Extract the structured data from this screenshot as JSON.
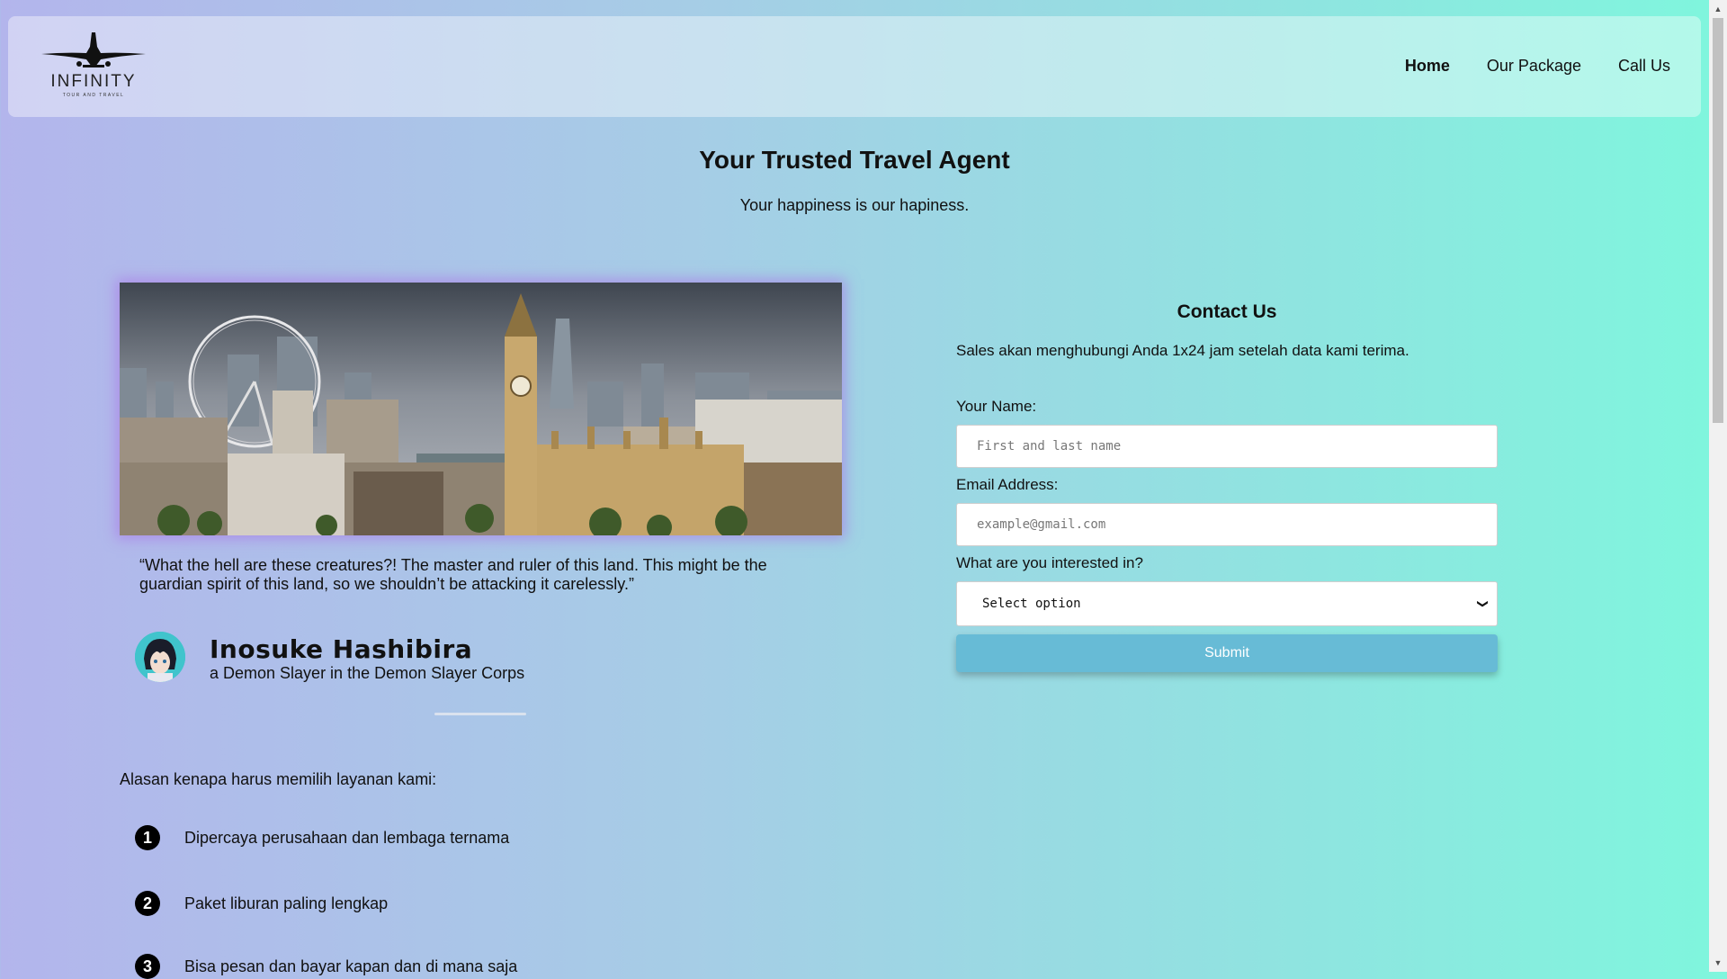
{
  "brand": {
    "name": "INFINITY",
    "tagline": "TOUR AND TRAVEL"
  },
  "nav": {
    "items": [
      {
        "label": "Home",
        "active": true
      },
      {
        "label": "Our Package",
        "active": false
      },
      {
        "label": "Call Us",
        "active": false
      }
    ]
  },
  "hero": {
    "title": "Your Trusted Travel Agent",
    "subtitle": "Your happiness is our hapiness."
  },
  "testimonial": {
    "quote": "“What the hell are these creatures?! The master and ruler of this land. This might be the guardian spirit of this land, so we shouldn’t be attacking it carelessly.”",
    "name": "Inosuke Hashibira",
    "role": "a Demon Slayer in the Demon Slayer Corps"
  },
  "reasons": {
    "title": "Alasan kenapa harus memilih layanan kami:",
    "items": [
      {
        "num": "1",
        "text": "Dipercaya perusahaan dan lembaga ternama"
      },
      {
        "num": "2",
        "text": "Paket liburan paling lengkap"
      },
      {
        "num": "3",
        "text": "Bisa pesan dan bayar kapan dan di mana saja"
      }
    ]
  },
  "contact": {
    "title": "Contact Us",
    "description": "Sales akan menghubungi Anda 1x24 jam setelah data kami terima.",
    "name_label": "Your Name:",
    "name_placeholder": "First and last name",
    "email_label": "Email Address:",
    "email_placeholder": "example@gmail.com",
    "interest_label": "What are you interested in?",
    "interest_selected": "Select option",
    "submit_label": "Submit"
  },
  "colors": {
    "submit": "#67bbd6",
    "bg_left": "#b3b5ec",
    "bg_right": "#7ff6dd"
  }
}
